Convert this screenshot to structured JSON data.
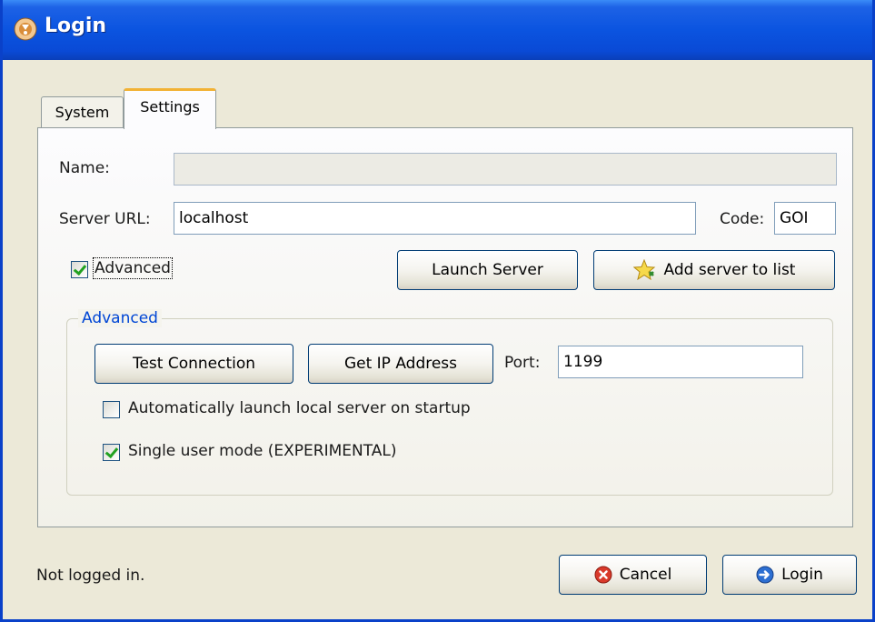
{
  "window": {
    "title": "Login"
  },
  "tabs": [
    {
      "label": "System"
    },
    {
      "label": "Settings"
    }
  ],
  "settings": {
    "name_label": "Name:",
    "name_value": "",
    "server_url_label": "Server URL:",
    "server_url_value": "localhost",
    "code_label": "Code:",
    "code_value": "GOI",
    "advanced_checkbox": {
      "label": "Advanced",
      "checked": true
    },
    "launch_server_label": "Launch Server",
    "add_server_label": "Add server to list"
  },
  "advanced_group": {
    "title": "Advanced",
    "test_connection_label": "Test Connection",
    "get_ip_label": "Get IP Address",
    "port_label": "Port:",
    "port_value": "1199",
    "auto_launch": {
      "label": "Automatically launch local server on startup",
      "checked": false
    },
    "single_user": {
      "label": "Single user mode (EXPERIMENTAL)",
      "checked": true
    }
  },
  "footer": {
    "status": "Not logged in.",
    "cancel_label": "Cancel",
    "login_label": "Login"
  },
  "icons": {
    "app": "app-icon",
    "star": "star-icon",
    "cancel": "cancel-icon",
    "login": "login-arrow-icon"
  },
  "colors": {
    "titlebar": "#0a54e0",
    "accent_tab": "#f2b235",
    "group_title": "#0046d5"
  }
}
